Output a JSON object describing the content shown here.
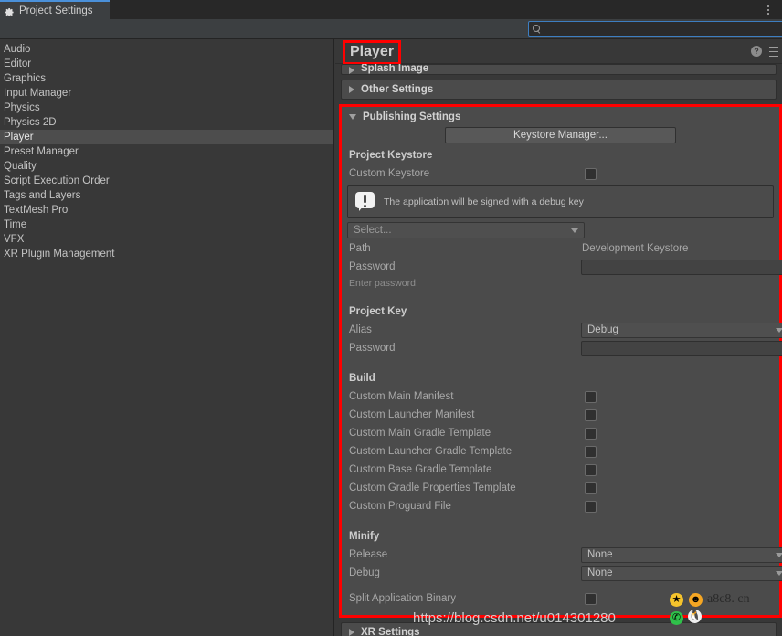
{
  "window": {
    "tab_label": "Project Settings",
    "tab_icon": "gear-icon",
    "kebab_icon": "more-vertical-icon"
  },
  "search": {
    "value": "",
    "placeholder": "",
    "icon": "search-icon"
  },
  "sidebar": {
    "items": [
      {
        "label": "Audio",
        "selected": false
      },
      {
        "label": "Editor",
        "selected": false
      },
      {
        "label": "Graphics",
        "selected": false
      },
      {
        "label": "Input Manager",
        "selected": false
      },
      {
        "label": "Physics",
        "selected": false
      },
      {
        "label": "Physics 2D",
        "selected": false
      },
      {
        "label": "Player",
        "selected": true
      },
      {
        "label": "Preset Manager",
        "selected": false
      },
      {
        "label": "Quality",
        "selected": false
      },
      {
        "label": "Script Execution Order",
        "selected": false
      },
      {
        "label": "Tags and Layers",
        "selected": false
      },
      {
        "label": "TextMesh Pro",
        "selected": false
      },
      {
        "label": "Time",
        "selected": false
      },
      {
        "label": "VFX",
        "selected": false
      },
      {
        "label": "XR Plugin Management",
        "selected": false
      }
    ]
  },
  "panel": {
    "title": "Player",
    "help_icon": "help-circle-icon",
    "menu_icon": "hamburger-menu-icon",
    "highlight_color": "#ff0000"
  },
  "foldouts": {
    "splash_image": "Splash Image",
    "other_settings": "Other Settings",
    "publishing_settings": "Publishing Settings",
    "xr_settings": "XR Settings"
  },
  "publishing": {
    "keystore_manager_button": "Keystore Manager...",
    "project_keystore_header": "Project Keystore",
    "custom_keystore_label": "Custom Keystore",
    "custom_keystore_checked": false,
    "info_message": "The application will be signed with a debug key",
    "info_icon": "warning-icon",
    "select_placeholder": "Select...",
    "path_label": "Path",
    "path_value": "Development Keystore",
    "keystore_password_label": "Password",
    "keystore_password_value": "",
    "password_hint": "Enter password.",
    "project_key_header": "Project Key",
    "alias_label": "Alias",
    "alias_value": "Debug",
    "key_password_label": "Password",
    "key_password_value": "",
    "build_header": "Build",
    "build_options": [
      {
        "label": "Custom Main Manifest",
        "checked": false
      },
      {
        "label": "Custom Launcher Manifest",
        "checked": false
      },
      {
        "label": "Custom Main Gradle Template",
        "checked": false
      },
      {
        "label": "Custom Launcher Gradle Template",
        "checked": false
      },
      {
        "label": "Custom Base Gradle Template",
        "checked": false
      },
      {
        "label": "Custom Gradle Properties Template",
        "checked": false
      },
      {
        "label": "Custom Proguard File",
        "checked": false
      }
    ],
    "minify_header": "Minify",
    "minify_release_label": "Release",
    "minify_release_value": "None",
    "minify_debug_label": "Debug",
    "minify_debug_value": "None",
    "split_binary_label": "Split Application Binary",
    "split_binary_checked": false
  },
  "watermark": {
    "url": "https://blog.csdn.net/u014301280",
    "site": "a8c8. cn"
  }
}
